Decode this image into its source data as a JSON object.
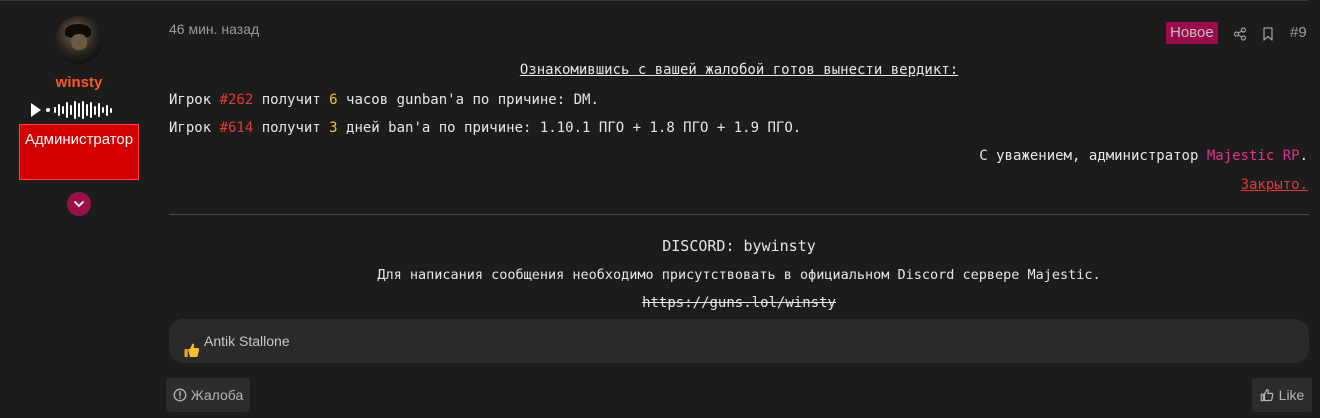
{
  "user": {
    "name": "winsty",
    "role": "Администратор"
  },
  "post": {
    "time": "46 мин. назад",
    "badge": "Новое",
    "number": "#9",
    "heading": "Ознакомившись с вашей жалобой готов вынести вердикт:",
    "line1": {
      "p1": "Игрок ",
      "id": "#262",
      "p2": " получит ",
      "count": "6",
      "p3": " часов gunban'a по причине: DM."
    },
    "line2": {
      "p1": "Игрок ",
      "id": "#614",
      "p2": " получит ",
      "count": "3",
      "p3": " дней ban'a по причине: 1.10.1 ПГО + 1.8 ПГО + 1.9 ПГО."
    },
    "regards": {
      "text": "С уважением, администратор ",
      "brand": "Majestic RP",
      "end": "."
    },
    "closed": "Закрыто."
  },
  "signature": {
    "discord": "DISCORD: bywinsty",
    "text": "Для написания сообщения необходимо присутствовать в официальном Discord сервере Majestic.",
    "link": "https://guns.lol/winsty"
  },
  "reactions": {
    "icon": "thumbs-up-emoji",
    "names": "Antik Stallone"
  },
  "actions": {
    "report_label": "Жалоба",
    "like_label": "Like"
  },
  "colors": {
    "accent": "#9b0a4a",
    "username": "#ff5722",
    "role_bg": "#d50000",
    "highlight_red": "#e53935",
    "highlight_yellow": "#f4c430",
    "brand_pink": "#e0338a"
  }
}
